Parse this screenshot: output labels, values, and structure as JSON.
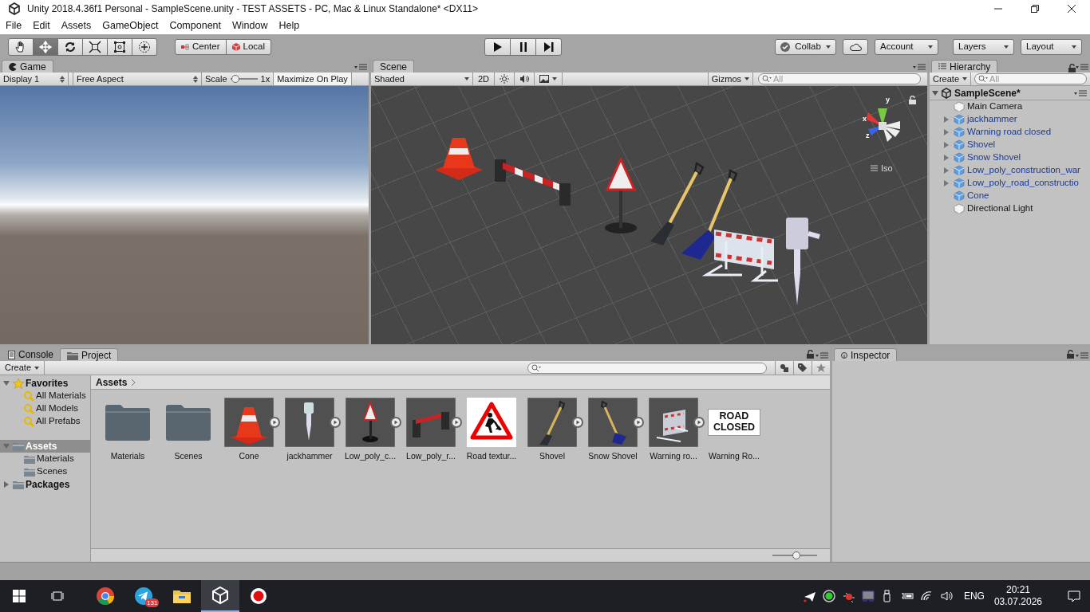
{
  "window": {
    "title": "Unity 2018.4.36f1 Personal - SampleScene.unity - TEST ASSETS - PC, Mac & Linux Standalone* <DX11>"
  },
  "menu": [
    "File",
    "Edit",
    "Assets",
    "GameObject",
    "Component",
    "Window",
    "Help"
  ],
  "toolbar": {
    "tools": [
      {
        "kind": "hand",
        "selected": false
      },
      {
        "kind": "move",
        "selected": true
      },
      {
        "kind": "rotate",
        "selected": false
      },
      {
        "kind": "scale",
        "selected": false
      },
      {
        "kind": "rect",
        "selected": false
      },
      {
        "kind": "transform",
        "selected": false
      }
    ],
    "pivot": [
      {
        "kind": "pivot",
        "label": "Center"
      },
      {
        "kind": "space",
        "label": "Local"
      }
    ],
    "playback": [
      {
        "kind": "play"
      },
      {
        "kind": "pause"
      },
      {
        "kind": "step"
      }
    ],
    "collab": "Collab",
    "account": "Account",
    "layers": "Layers",
    "layout": "Layout"
  },
  "game": {
    "tab": "Game",
    "display": "Display 1",
    "aspect": "Free Aspect",
    "scale_label": "Scale",
    "scale": {
      "level": 0.05
    },
    "scale_value": "1x",
    "maximize": "Maximize On Play"
  },
  "scene": {
    "tab": "Scene",
    "shading": "Shaded",
    "mode_2d": "2D",
    "gizmos": "Gizmos",
    "search_placeholder": "All",
    "axes": [
      "y",
      "x",
      "z"
    ],
    "projection": "Iso"
  },
  "hierarchy": {
    "tab": "Hierarchy",
    "create": "Create",
    "search_placeholder": "All",
    "scene": {
      "label": "SampleScene*",
      "expanded": true,
      "children": [
        {
          "label": "Main Camera",
          "kind": "object",
          "expandable": false,
          "selected": false
        },
        {
          "label": "jackhammer",
          "kind": "prefab",
          "expandable": true,
          "selected": false
        },
        {
          "label": "Warning road closed",
          "kind": "prefab",
          "expandable": true,
          "selected": false
        },
        {
          "label": "Shovel",
          "kind": "prefab",
          "expandable": true,
          "selected": false
        },
        {
          "label": "Snow Shovel",
          "kind": "prefab",
          "expandable": true,
          "selected": false
        },
        {
          "label": "Low_poly_construction_war",
          "kind": "prefab",
          "expandable": true,
          "selected": false
        },
        {
          "label": "Low_poly_road_constructio",
          "kind": "prefab",
          "expandable": true,
          "selected": false
        },
        {
          "label": "Cone",
          "kind": "prefab",
          "expandable": false,
          "selected": false
        },
        {
          "label": "Directional Light",
          "kind": "object",
          "expandable": false,
          "selected": false
        }
      ]
    }
  },
  "project": {
    "tabs": [
      {
        "label": "Console",
        "kind": "console",
        "selected": false
      },
      {
        "label": "Project",
        "kind": "folder",
        "selected": true
      }
    ],
    "create": "Create",
    "tree": [
      {
        "label": "Favorites",
        "kind": "favorites",
        "expanded": true,
        "selected": false,
        "children": [
          {
            "label": "All Materials",
            "kind": "search",
            "selected": false
          },
          {
            "label": "All Models",
            "kind": "search",
            "selected": false
          },
          {
            "label": "All Prefabs",
            "kind": "search",
            "selected": false
          }
        ]
      },
      {
        "label": "Assets",
        "kind": "folder",
        "expanded": true,
        "selected": true,
        "children": [
          {
            "label": "Materials",
            "kind": "folder",
            "selected": false
          },
          {
            "label": "Scenes",
            "kind": "folder",
            "selected": false
          }
        ]
      },
      {
        "label": "Packages",
        "kind": "folder",
        "expanded": false,
        "selected": false
      }
    ],
    "breadcrumb": "Assets",
    "assets": [
      {
        "label": "Materials",
        "kind": "folder",
        "selected": false
      },
      {
        "label": "Scenes",
        "kind": "folder",
        "selected": false
      },
      {
        "label": "Cone",
        "kind": "cone",
        "selected": false
      },
      {
        "label": "jackhammer",
        "kind": "jackhammer",
        "selected": false
      },
      {
        "label": "Low_poly_c...",
        "kind": "sign",
        "selected": false
      },
      {
        "label": "Low_poly_r...",
        "kind": "barrier",
        "selected": false
      },
      {
        "label": "Road textur...",
        "kind": "road-sign",
        "selected": false
      },
      {
        "label": "Shovel",
        "kind": "shovel",
        "selected": false
      },
      {
        "label": "Snow Shovel",
        "kind": "snow-shovel",
        "selected": false
      },
      {
        "label": "Warning ro...",
        "kind": "warning-barrier",
        "selected": false
      },
      {
        "label": "Warning Ro...",
        "kind": "road-closed",
        "thumb_text": "ROAD CLOSED",
        "selected": false
      }
    ],
    "zoom": {
      "level": 0.55
    }
  },
  "inspector": {
    "tab": "Inspector"
  },
  "taskbar": {
    "apps": [
      {
        "kind": "chrome",
        "selected": false
      },
      {
        "kind": "telegram",
        "selected": false,
        "badge": "131"
      },
      {
        "kind": "explorer",
        "selected": false
      },
      {
        "kind": "unity",
        "selected": true
      },
      {
        "kind": "recorder",
        "selected": false
      }
    ],
    "language": "ENG",
    "time": "20:21",
    "date": "03.07.2026"
  }
}
